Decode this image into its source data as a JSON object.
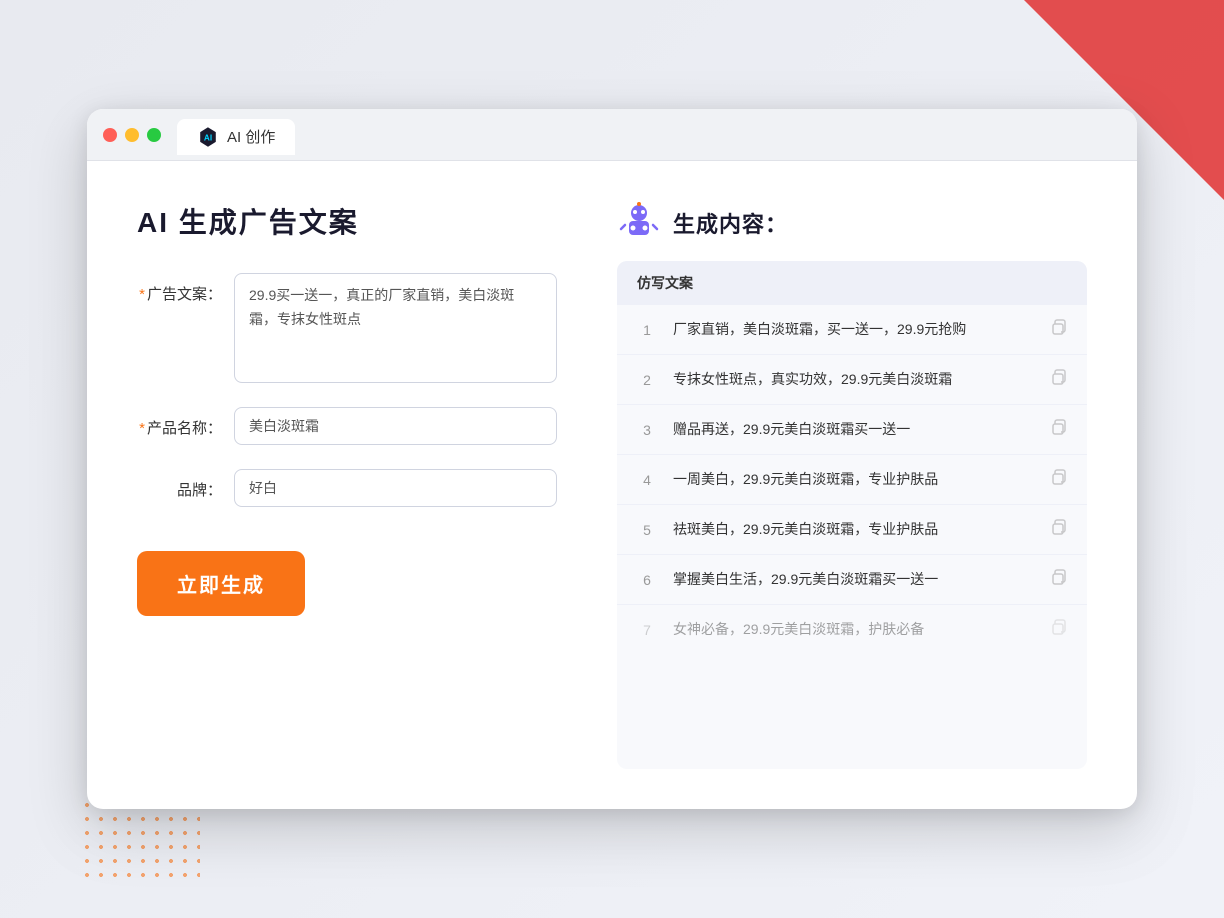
{
  "browser": {
    "tab_title": "AI 创作",
    "controls": {
      "close": "close",
      "minimize": "minimize",
      "maximize": "maximize"
    }
  },
  "left_panel": {
    "main_title": "AI 生成广告文案",
    "form": {
      "ad_copy_label": "广告文案：",
      "ad_copy_required": "*",
      "ad_copy_value": "29.9买一送一，真正的厂家直销，美白淡斑霜，专抹女性斑点",
      "product_name_label": "产品名称：",
      "product_name_required": "*",
      "product_name_value": "美白淡斑霜",
      "brand_label": "品牌：",
      "brand_value": "好白"
    },
    "generate_btn": "立即生成"
  },
  "right_panel": {
    "title": "生成内容：",
    "table_header": "仿写文案",
    "results": [
      {
        "num": "1",
        "text": "厂家直销，美白淡斑霜，买一送一，29.9元抢购",
        "dimmed": false
      },
      {
        "num": "2",
        "text": "专抹女性斑点，真实功效，29.9元美白淡斑霜",
        "dimmed": false
      },
      {
        "num": "3",
        "text": "赠品再送，29.9元美白淡斑霜买一送一",
        "dimmed": false
      },
      {
        "num": "4",
        "text": "一周美白，29.9元美白淡斑霜，专业护肤品",
        "dimmed": false
      },
      {
        "num": "5",
        "text": "祛斑美白，29.9元美白淡斑霜，专业护肤品",
        "dimmed": false
      },
      {
        "num": "6",
        "text": "掌握美白生活，29.9元美白淡斑霜买一送一",
        "dimmed": false
      },
      {
        "num": "7",
        "text": "女神必备，29.9元美白淡斑霜，护肤必备",
        "dimmed": true
      }
    ]
  },
  "colors": {
    "accent_orange": "#f97316",
    "required_red": "#f97316",
    "primary_dark": "#1a1a2e"
  }
}
